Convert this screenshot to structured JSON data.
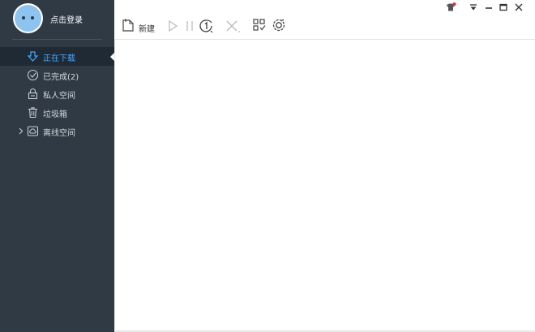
{
  "user": {
    "login_label": "点击登录"
  },
  "toolbar": {
    "new_label": "新建"
  },
  "sidebar": {
    "items": [
      {
        "label": "正在下载",
        "icon": "download-arrow-icon",
        "active": true
      },
      {
        "label": "已完成(2)",
        "icon": "check-circle-icon",
        "active": false
      },
      {
        "label": "私人空间",
        "icon": "lock-icon",
        "active": false
      },
      {
        "label": "垃圾箱",
        "icon": "trash-icon",
        "active": false
      },
      {
        "label": "离线空间",
        "icon": "cloud-icon",
        "active": false,
        "expandable": true
      }
    ]
  },
  "colors": {
    "sidebar_bg": "#2f3a44",
    "active_bg": "#1f2a34",
    "accent": "#4aa7ff",
    "badge": "#e0303a"
  }
}
